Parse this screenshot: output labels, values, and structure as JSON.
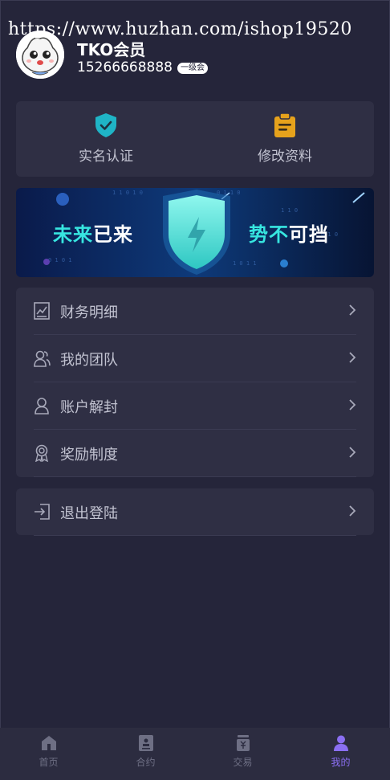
{
  "watermark": "https://www.huzhan.com/ishop19520",
  "profile": {
    "name": "TKO会员",
    "phone": "15266668888",
    "level_badge": "一级会"
  },
  "quick_actions": [
    {
      "label": "实名认证",
      "icon": "shield-check-icon",
      "color": "#1fb4c6"
    },
    {
      "label": "修改资料",
      "icon": "clipboard-edit-icon",
      "color": "#e6a21c"
    }
  ],
  "banner": {
    "left_text_a": "未来",
    "left_text_b": "已来",
    "right_text_a": "势不",
    "right_text_b": "可挡",
    "accent": "#37e6e0"
  },
  "menu": [
    {
      "label": "财务明细",
      "icon": "finance-chart-icon"
    },
    {
      "label": "我的团队",
      "icon": "team-icon"
    },
    {
      "label": "账户解封",
      "icon": "user-unlock-icon"
    },
    {
      "label": "奖励制度",
      "icon": "award-medal-icon"
    }
  ],
  "menu_secondary": [
    {
      "label": "退出登陆",
      "icon": "logout-icon"
    }
  ],
  "tabbar": [
    {
      "label": "首页",
      "icon": "home-icon"
    },
    {
      "label": "合约",
      "icon": "contract-icon"
    },
    {
      "label": "交易",
      "icon": "trade-icon"
    },
    {
      "label": "我的",
      "icon": "profile-icon",
      "active": true
    }
  ],
  "colors": {
    "background": "#25253a",
    "card": "#2f2f44",
    "active_tab": "#8b6ff2"
  }
}
